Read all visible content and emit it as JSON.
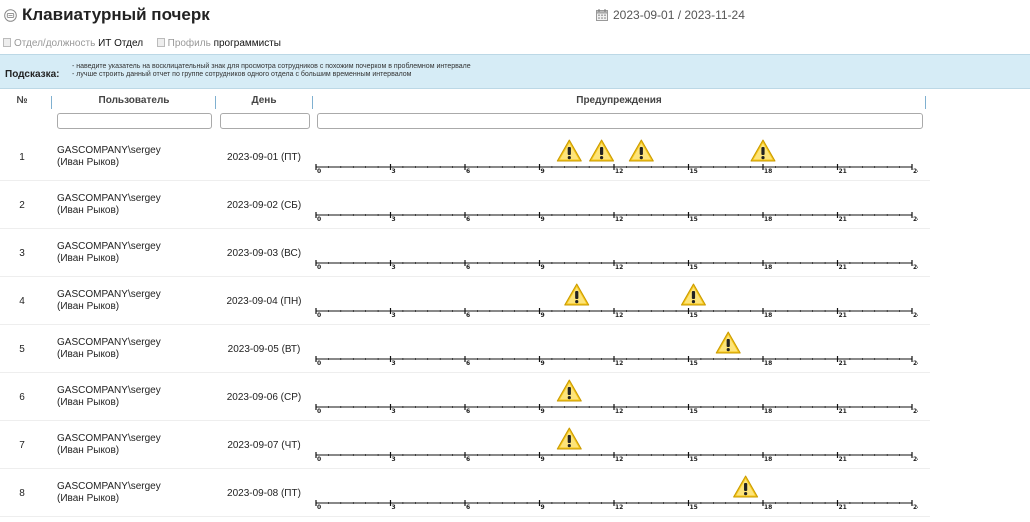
{
  "header": {
    "title": "Клавиатурный почерк",
    "date_range": "2023-09-01 / 2023-11-24"
  },
  "filters": {
    "dept_label": "Отдел/должность",
    "dept_value": "ИТ Отдел",
    "profile_label": "Профиль",
    "profile_value": "программисты"
  },
  "hint": {
    "label": "Подсказка:",
    "lines": [
      "- наведите указатель на восклицательный знак для просмотра сотрудников с похожим почерком в проблемном интервале",
      "- лучше строить данный отчет по группе сотрудников одного отдела с большим временным интервалом"
    ]
  },
  "columns": {
    "num": "№",
    "user": "Пользователь",
    "day": "День",
    "warnings": "Предупреждения"
  },
  "axis_ticks": [
    "0",
    "3",
    "6",
    "9",
    "12",
    "15",
    "18",
    "21",
    "24"
  ],
  "rows": [
    {
      "num": "1",
      "user": "GASCOMPANY\\sergey",
      "name": "(Иван Рыков)",
      "day": "2023-09-01 (ПТ)",
      "warnings": [
        10.2,
        11.5,
        13.1,
        18.0
      ]
    },
    {
      "num": "2",
      "user": "GASCOMPANY\\sergey",
      "name": "(Иван Рыков)",
      "day": "2023-09-02 (СБ)",
      "warnings": []
    },
    {
      "num": "3",
      "user": "GASCOMPANY\\sergey",
      "name": "(Иван Рыков)",
      "day": "2023-09-03 (ВС)",
      "warnings": []
    },
    {
      "num": "4",
      "user": "GASCOMPANY\\sergey",
      "name": "(Иван Рыков)",
      "day": "2023-09-04 (ПН)",
      "warnings": [
        10.5,
        15.2
      ]
    },
    {
      "num": "5",
      "user": "GASCOMPANY\\sergey",
      "name": "(Иван Рыков)",
      "day": "2023-09-05 (ВТ)",
      "warnings": [
        16.6
      ]
    },
    {
      "num": "6",
      "user": "GASCOMPANY\\sergey",
      "name": "(Иван Рыков)",
      "day": "2023-09-06 (СР)",
      "warnings": [
        10.2
      ]
    },
    {
      "num": "7",
      "user": "GASCOMPANY\\sergey",
      "name": "(Иван Рыков)",
      "day": "2023-09-07 (ЧТ)",
      "warnings": [
        10.2
      ]
    },
    {
      "num": "8",
      "user": "GASCOMPANY\\sergey",
      "name": "(Иван Рыков)",
      "day": "2023-09-08 (ПТ)",
      "warnings": [
        17.3
      ]
    }
  ]
}
